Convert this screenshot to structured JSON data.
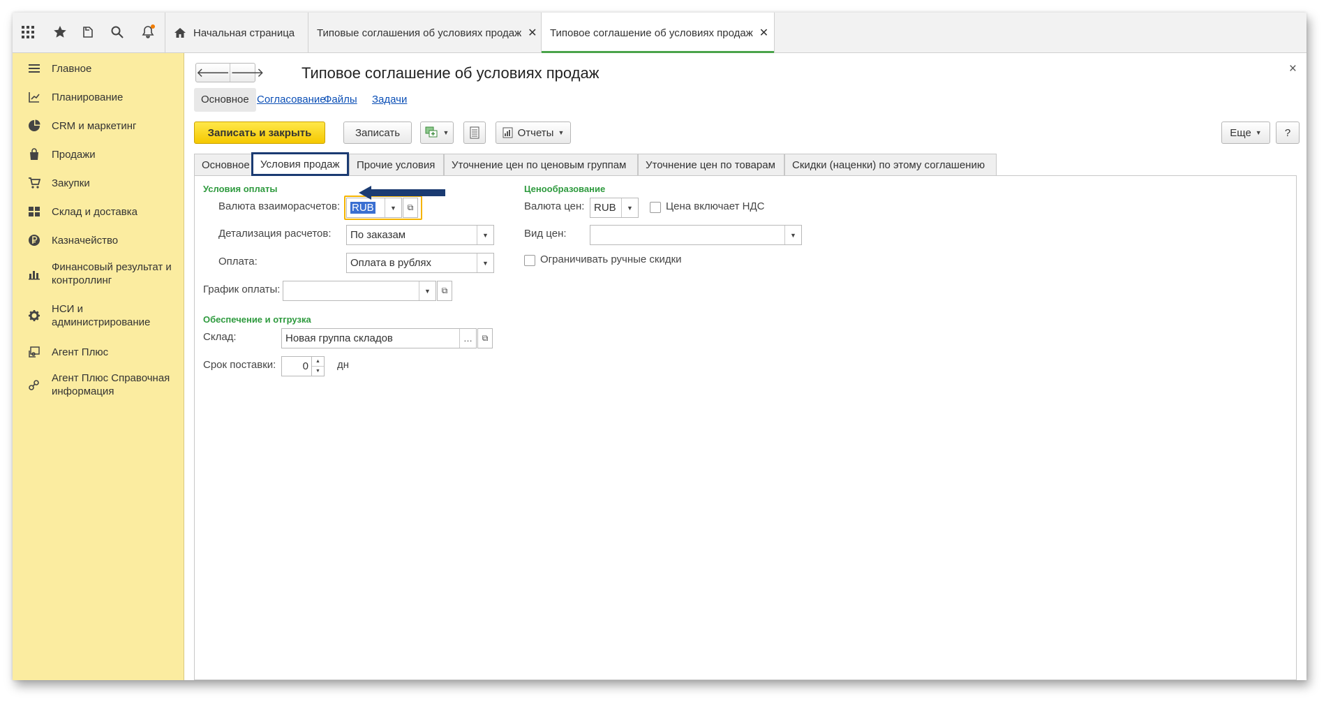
{
  "top_tabs": [
    {
      "label": "Начальная страница",
      "closable": false
    },
    {
      "label": "Типовые соглашения об условиях продаж",
      "closable": true
    },
    {
      "label": "Типовое соглашение об условиях продаж",
      "closable": true,
      "active": true
    }
  ],
  "top_icons": [
    "apps-grid-icon",
    "star-icon",
    "history-icon",
    "search-icon",
    "bell-icon"
  ],
  "sidebar": {
    "items": [
      {
        "label": "Главное",
        "icon": "menu-lines-icon"
      },
      {
        "label": "Планирование",
        "icon": "planning-icon"
      },
      {
        "label": "CRM и маркетинг",
        "icon": "pie-chart-icon"
      },
      {
        "label": "Продажи",
        "icon": "shopping-bag-icon"
      },
      {
        "label": "Закупки",
        "icon": "cart-icon"
      },
      {
        "label": "Склад и доставка",
        "icon": "warehouse-grid-icon"
      },
      {
        "label": "Казначейство",
        "icon": "ruble-coin-icon"
      },
      {
        "label": "Финансовый результат и контроллинг",
        "icon": "bar-chart-icon"
      },
      {
        "label": "НСИ и администрирование",
        "icon": "gear-icon"
      },
      {
        "label": "Агент Плюс",
        "icon": "agent-monitor-icon"
      },
      {
        "label": "Агент Плюс Справочная информация",
        "icon": "agent-link-icon"
      }
    ]
  },
  "form": {
    "title": "Типовое соглашение об условиях продаж",
    "close": "×",
    "nav_back": "🡐",
    "nav_forward": "🡒",
    "sub_tabs": [
      {
        "label": "Основное",
        "active": true
      },
      {
        "label": "Согласование"
      },
      {
        "label": "Файлы"
      },
      {
        "label": "Задачи"
      }
    ],
    "toolbar": {
      "save_close": "Записать и закрыть",
      "save": "Записать",
      "reports": "Отчеты",
      "more": "Еще",
      "help": "?"
    },
    "tabs": [
      {
        "label": "Основное"
      },
      {
        "label": "Условия продаж",
        "active": true
      },
      {
        "label": "Прочие условия"
      },
      {
        "label": "Уточнение цен по ценовым группам"
      },
      {
        "label": "Уточнение цен по товарам"
      },
      {
        "label": "Скидки (наценки) по этому соглашению"
      }
    ],
    "payment": {
      "group_title": "Условия оплаты",
      "currency_label": "Валюта взаиморасчетов:",
      "currency_value": "RUB",
      "detail_label": "Детализация расчетов:",
      "detail_value": "По заказам",
      "payment_label": "Оплата:",
      "payment_value": "Оплата в рублях",
      "schedule_label": "График оплаты:",
      "schedule_value": ""
    },
    "pricing": {
      "group_title": "Ценообразование",
      "price_currency_label": "Валюта цен:",
      "price_currency_value": "RUB",
      "vat_label": "Цена включает НДС",
      "vat_checked": false,
      "price_type_label": "Вид цен:",
      "price_type_value": "",
      "limit_discounts_label": "Ограничивать ручные скидки",
      "limit_discounts_checked": false
    },
    "shipping": {
      "group_title": "Обеспечение и отгрузка",
      "warehouse_label": "Склад:",
      "warehouse_value": "Новая группа складов",
      "lead_time_label": "Срок поставки:",
      "lead_time_value": "0",
      "lead_time_unit": "дн"
    }
  },
  "colors": {
    "sidebar_bg": "#fbeca0",
    "primary_button": "#f5c800",
    "group_title": "#2e9a3e",
    "link": "#0b4fb6",
    "active_tab_frame": "#1b3b72",
    "annotation_arrow": "#1b3b72",
    "focus_highlight": "#f5b400"
  }
}
